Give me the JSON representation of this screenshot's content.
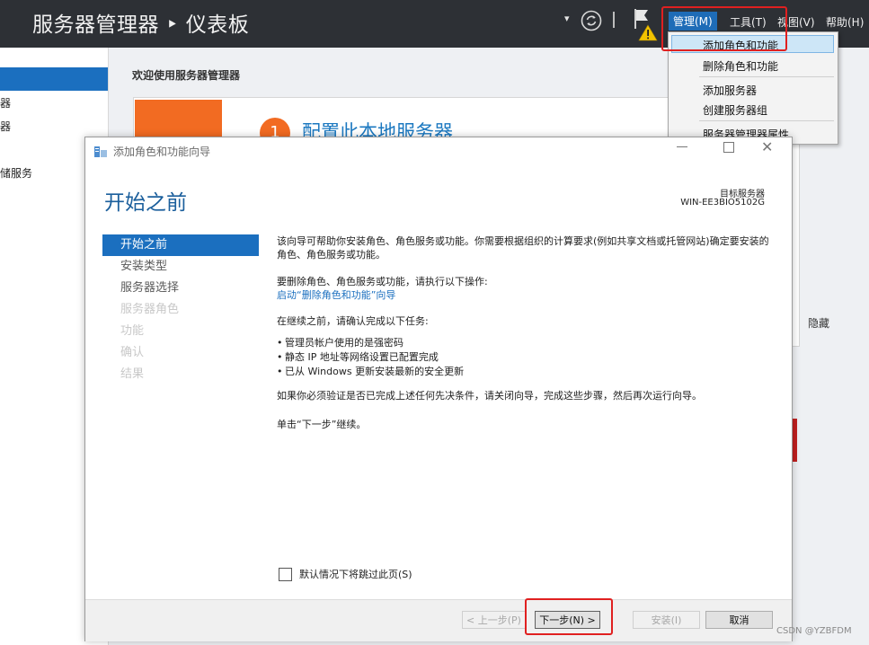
{
  "titlebar": {
    "app_title": "服务器管理器 ‣ 仪表板",
    "menus": [
      "管理(M)",
      "工具(T)",
      "视图(V)",
      "帮助(H)"
    ]
  },
  "leftnav": {
    "fragments": [
      "器",
      "器",
      "储服务"
    ]
  },
  "dashboard": {
    "welcome": "欢迎使用服务器管理器",
    "step_number": "1",
    "step_heading": "配置此本地服务器",
    "hide": "隐藏"
  },
  "dropdown": {
    "items": [
      "添加角色和功能",
      "删除角色和功能",
      "添加服务器",
      "创建服务器组",
      "服务器管理器属性"
    ]
  },
  "wizard": {
    "window_title": "添加角色和功能向导",
    "heading": "开始之前",
    "target_label": "目标服务器",
    "target_name": "WIN-EE3BIO5102G",
    "steps": [
      {
        "label": "开始之前",
        "state": "active"
      },
      {
        "label": "安装类型",
        "state": "enabled"
      },
      {
        "label": "服务器选择",
        "state": "enabled"
      },
      {
        "label": "服务器角色",
        "state": "disabled"
      },
      {
        "label": "功能",
        "state": "disabled"
      },
      {
        "label": "确认",
        "state": "disabled"
      },
      {
        "label": "结果",
        "state": "disabled"
      }
    ],
    "intro": "该向导可帮助你安装角色、角色服务或功能。你需要根据组织的计算要求(例如共享文档或托管网站)确定要安装的角色、角色服务或功能。",
    "remove_prompt": "要删除角色、角色服务或功能，请执行以下操作:",
    "remove_link": "启动“删除角色和功能”向导",
    "tasks_prompt": "在继续之前，请确认完成以下任务:",
    "tasks": [
      "管理员帐户使用的是强密码",
      "静态 IP 地址等网络设置已配置完成",
      "已从 Windows 更新安装最新的安全更新"
    ],
    "verify_note": "如果你必须验证是否已完成上述任何先决条件，请关闭向导，完成这些步骤，然后再次运行向导。",
    "continue_note": "单击“下一步”继续。",
    "skip_label": "默认情况下将跳过此页(S)",
    "buttons": {
      "prev": "< 上一步(P)",
      "next": "下一步(N) >",
      "install": "安装(I)",
      "cancel": "取消"
    }
  },
  "watermark": "CSDN @YZBFDM",
  "colors": {
    "titlebar_bg": "#2d3035",
    "accent_blue": "#1b6fbf",
    "orange": "#f26b22",
    "highlight_red": "#e02020"
  }
}
